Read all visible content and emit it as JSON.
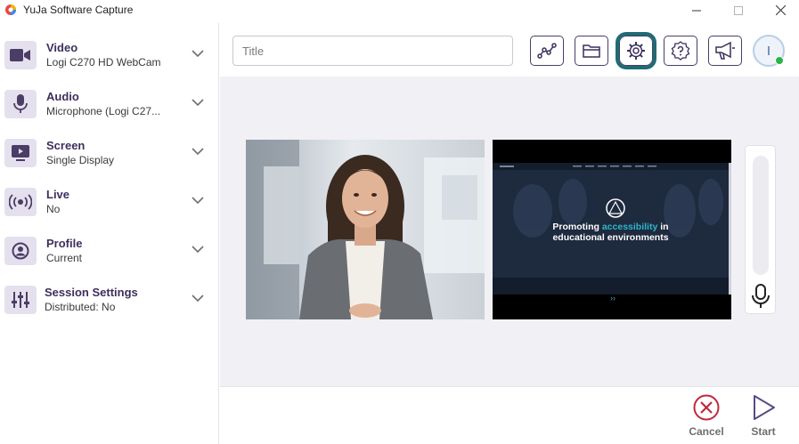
{
  "window": {
    "title": "YuJa Software Capture"
  },
  "sidebar": {
    "items": [
      {
        "title": "Video",
        "subtitle": "Logi C270 HD WebCam",
        "icon": "video-camera-icon"
      },
      {
        "title": "Audio",
        "subtitle": "Microphone (Logi C27...",
        "icon": "microphone-icon"
      },
      {
        "title": "Screen",
        "subtitle": "Single Display",
        "icon": "screen-play-icon"
      },
      {
        "title": "Live",
        "subtitle": "No",
        "icon": "broadcast-icon"
      },
      {
        "title": "Profile",
        "subtitle": "Current",
        "icon": "profile-icon"
      },
      {
        "title": "Session Settings",
        "subtitle": "Distributed: No",
        "icon": "sliders-icon"
      }
    ]
  },
  "toolbar": {
    "title_placeholder": "Title",
    "title_value": "",
    "buttons": [
      "analytics-icon",
      "folder-icon",
      "settings-gear-icon",
      "help-icon",
      "announcement-icon"
    ],
    "active_button": "settings-gear-icon",
    "avatar_letter": "I",
    "avatar_status": "online"
  },
  "screen_preview": {
    "headline_part1": "Promoting ",
    "headline_highlight": "accessibility",
    "headline_part2": " in",
    "headline_line2": "educational environments"
  },
  "actions": {
    "cancel_label": "Cancel",
    "start_label": "Start"
  },
  "colors": {
    "brand_purple": "#3d2f5c",
    "active_ring": "#1e6b73",
    "cancel_red": "#c0283c",
    "start_purple": "#5a4a85",
    "accent_teal": "#2fb6c9"
  }
}
